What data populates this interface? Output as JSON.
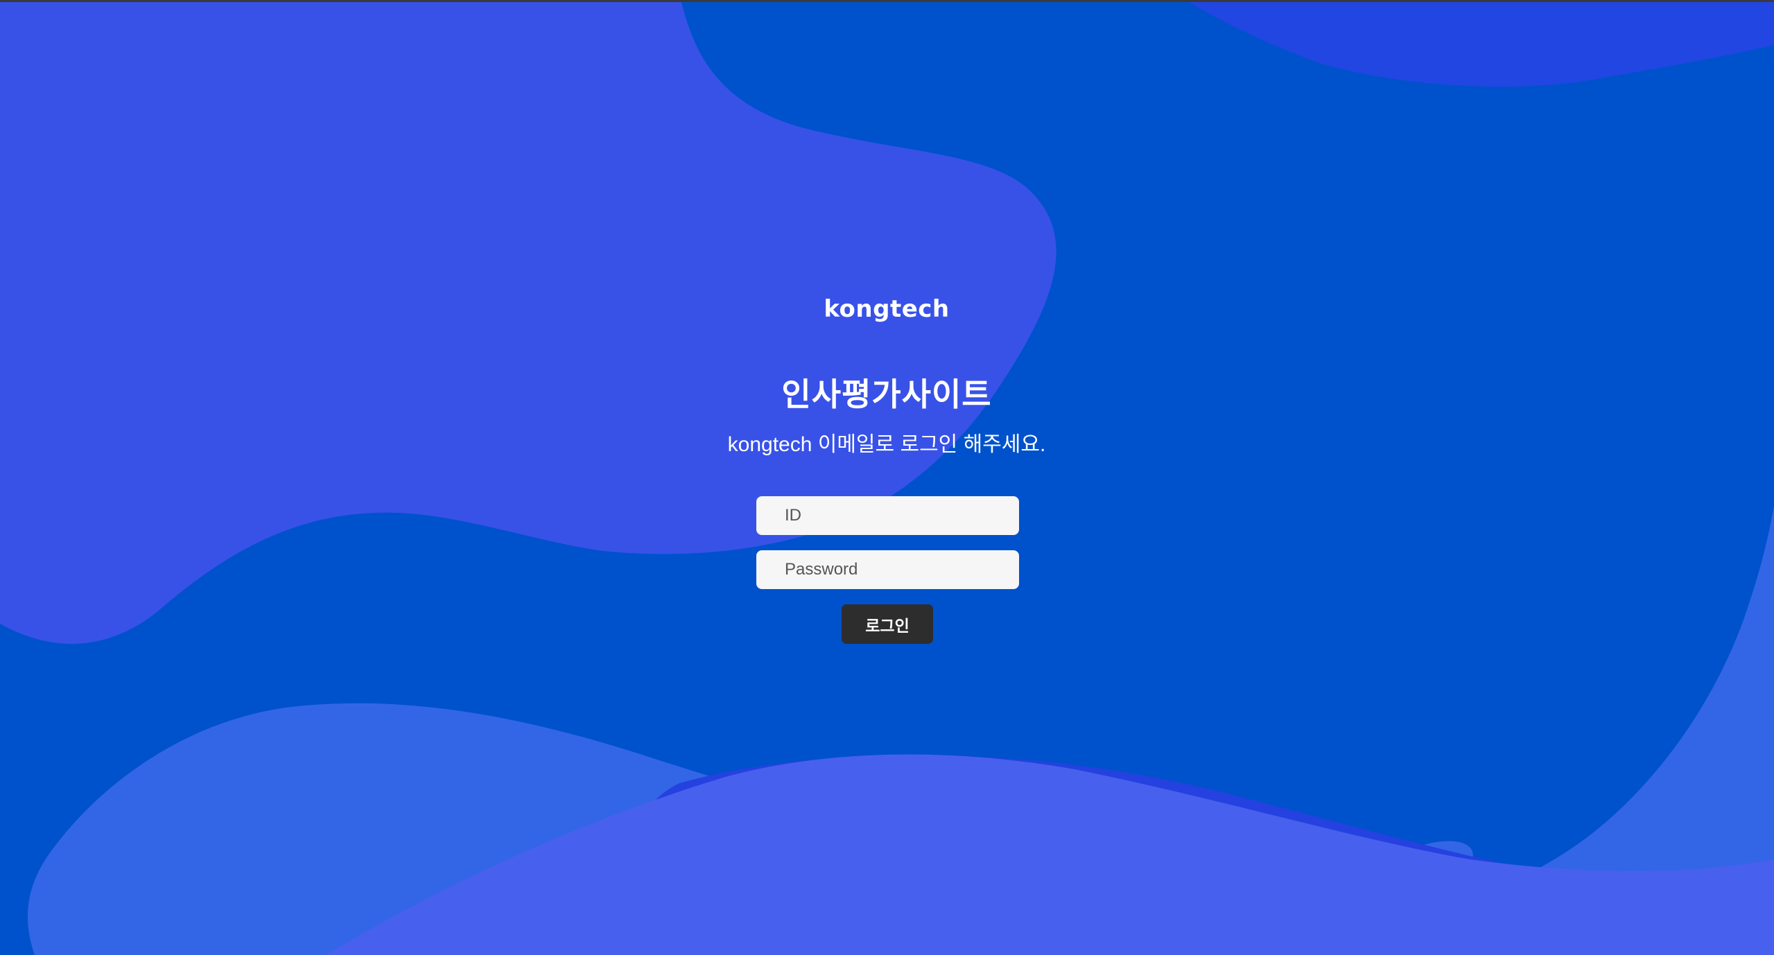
{
  "brand": {
    "logo_text": "kongtech"
  },
  "main": {
    "title": "인사평가사이트",
    "subtitle": "kongtech 이메일로 로그인 해주세요."
  },
  "login_form": {
    "id_placeholder": "ID",
    "password_placeholder": "Password",
    "submit_label": "로그인"
  },
  "colors": {
    "background_base": "#0052cc",
    "wave_light_blue": "#3852e8",
    "wave_deep": "#2541e0",
    "wave_bottom_light": "#3366e6",
    "wave_bottom_violet": "#4860ee",
    "input_background": "#f6f6f6",
    "button_background": "#2d2d2d",
    "text_white": "#ffffff"
  }
}
